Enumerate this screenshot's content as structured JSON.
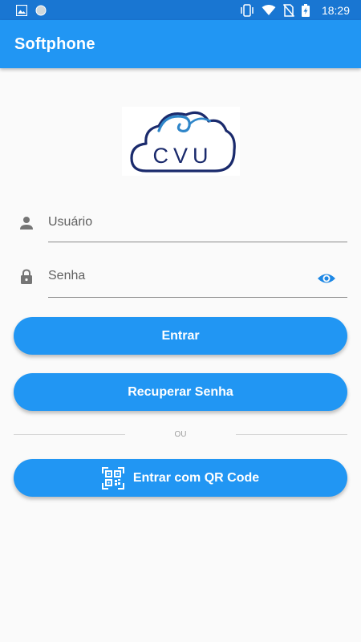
{
  "status_bar": {
    "time": "18:29",
    "icons": [
      "image-icon",
      "circle-icon",
      "vibrate-icon",
      "wifi-icon",
      "no-sim-icon",
      "battery-charging-icon"
    ]
  },
  "app_bar": {
    "title": "Softphone"
  },
  "logo": {
    "text": "CVU",
    "brand_color": "#1a2a6c",
    "accent_color": "#2f86c9"
  },
  "form": {
    "username": {
      "label": "Usuário",
      "icon": "person-icon"
    },
    "password": {
      "label": "Senha",
      "icon": "lock-icon",
      "toggle_icon": "eye-icon"
    }
  },
  "buttons": {
    "login": "Entrar",
    "recover": "Recuperar Senha",
    "qr": "Entrar com QR Code"
  },
  "divider_text": "OU",
  "colors": {
    "primary": "#2196f3",
    "status_bar": "#1976d2"
  }
}
